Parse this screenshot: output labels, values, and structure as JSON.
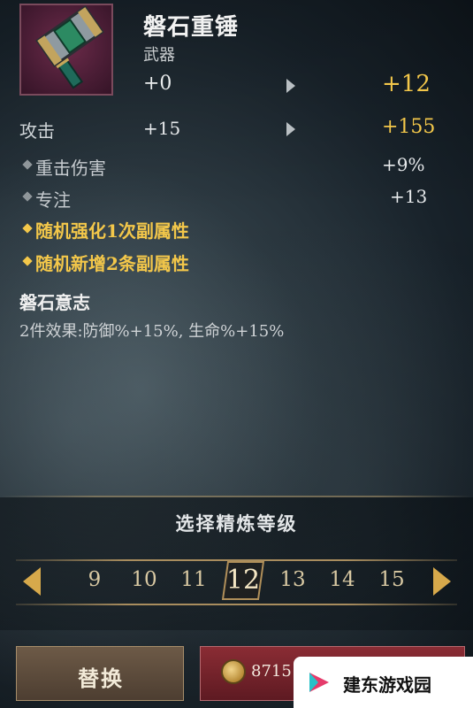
{
  "item": {
    "name": "磐石重锤",
    "type": "武器",
    "level_current": "+0",
    "level_next": "+12",
    "icon": "hammer-icon"
  },
  "main_stat": {
    "label": "攻击",
    "current": "+15",
    "next": "+155"
  },
  "sub_stats": [
    {
      "label": "重击伤害",
      "value": "+9%"
    },
    {
      "label": "专注",
      "value": "+13"
    }
  ],
  "upgrades": [
    {
      "label": "随机强化1次副属性"
    },
    {
      "label": "随机新增2条副属性"
    }
  ],
  "set": {
    "title": "磐石意志",
    "effect": "2件效果:防御%+15%, 生命%+15%"
  },
  "refine": {
    "title": "选择精炼等级",
    "levels": [
      "9",
      "10",
      "11",
      "12",
      "13",
      "14",
      "15"
    ],
    "selected": "12"
  },
  "buttons": {
    "replace": "替换",
    "cost": "8715"
  },
  "watermark": {
    "text": "建东游戏园"
  },
  "colors": {
    "accent_gold": "#f3c74a",
    "confirm_red": "#8a2c34"
  }
}
